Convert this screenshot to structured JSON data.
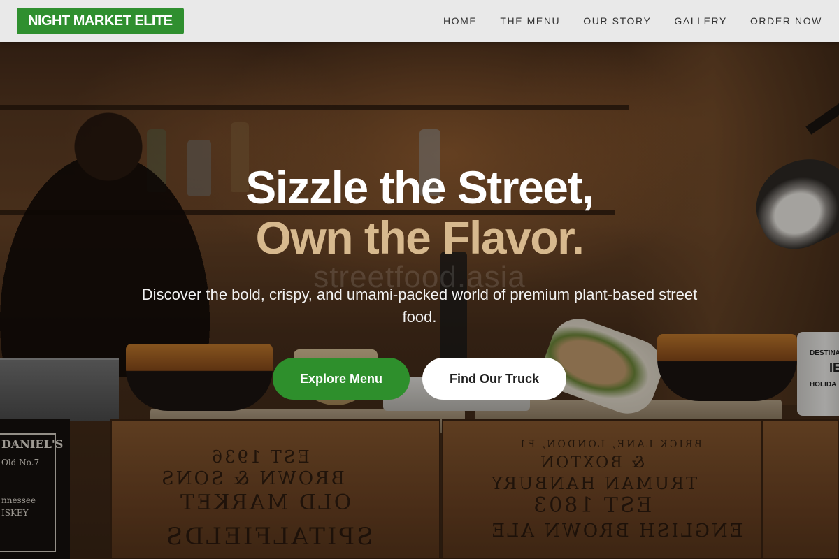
{
  "brand": {
    "name": "NIGHT MARKET ELITE",
    "color": "#2f8f2f"
  },
  "nav": {
    "items": [
      {
        "label": "HOME"
      },
      {
        "label": "THE MENU"
      },
      {
        "label": "OUR STORY"
      },
      {
        "label": "GALLERY"
      },
      {
        "label": "ORDER NOW"
      }
    ]
  },
  "hero": {
    "headline_line1": "Sizzle the Street,",
    "headline_line2": "Own the Flavor.",
    "watermark": "streetfood.asia",
    "subtitle": "Discover the bold, crispy, and umami-packed world of premium plant-based street food.",
    "primary_cta": "Explore Menu",
    "secondary_cta": "Find Our Truck",
    "accent_color": "#d7b98e",
    "primary_color": "#2e8f2c"
  },
  "background_photo": {
    "crate_left": [
      "EST 1936",
      "BROWN & SONS",
      "OLD MARKET",
      "SPITALFIELDS"
    ],
    "crate_right": [
      "BRICK LANE, LONDON, E1",
      "& BOXTON",
      "TRUMAN HANBURY",
      "EST 1803",
      "ENGLISH BROWN ALE"
    ],
    "whiskey_label": [
      "DANIEL'S",
      "Old No.7",
      "nnessee",
      "ISKEY"
    ],
    "mug_label": [
      "DESTINAT",
      "IE",
      "HOLIDA"
    ]
  }
}
